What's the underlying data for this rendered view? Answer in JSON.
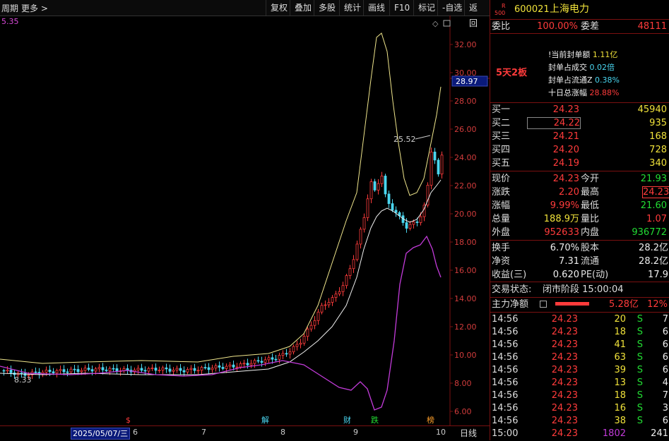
{
  "toolbar": {
    "period_label": "周期",
    "more_label": "更多 >",
    "buttons": [
      "复权",
      "叠加",
      "多股",
      "统计",
      "画线",
      "F10",
      "标记",
      "-自选",
      "返回"
    ]
  },
  "chart": {
    "ma_label": "5.35",
    "price_labels": [
      "32.00",
      "30.00",
      "28.00",
      "26.00",
      "24.00",
      "22.00",
      "20.00",
      "18.00",
      "16.00",
      "14.00",
      "12.00",
      "10.00",
      "8.00",
      "6.00"
    ],
    "current_price_tag": "28.97",
    "high_annotation": "25.52",
    "low_annotation": "8.33",
    "markers": [
      "$",
      "解",
      "财",
      "跌",
      "榜"
    ],
    "colors": {
      "up": "#ff3b3b",
      "down": "#4ad6f0",
      "band": "#f0e68c",
      "ma": "#c23bd9",
      "axis": "#7a1010"
    }
  },
  "bottom": {
    "date": "2025/05/07/三",
    "months": [
      "6",
      "7",
      "8",
      "9",
      "10"
    ],
    "period": "日线"
  },
  "panel": {
    "r_badge": "R",
    "code_badge": "500",
    "code": "600021",
    "name": "上海电力",
    "weibi_label": "委比",
    "weibi_value": "100.00%",
    "weicha_label": "委差",
    "weicha_value": "48111",
    "board_tag": "5天2板",
    "seal": [
      {
        "label": "!当前封单额",
        "value": "1.11亿"
      },
      {
        "label": "封单占成交",
        "value": "0.02倍"
      },
      {
        "label": "封单占流通Z",
        "value": "0.38%"
      },
      {
        "label": "十日总涨幅",
        "value": "28.88%"
      }
    ],
    "bids": [
      {
        "label": "买一",
        "price": "24.23",
        "volume": "45940"
      },
      {
        "label": "买二",
        "price": "24.22",
        "volume": "935"
      },
      {
        "label": "买三",
        "price": "24.21",
        "volume": "168"
      },
      {
        "label": "买四",
        "price": "24.20",
        "volume": "728"
      },
      {
        "label": "买五",
        "price": "24.19",
        "volume": "340"
      }
    ],
    "quote": [
      {
        "l1": "现价",
        "v1": "24.23",
        "l2": "今开",
        "v2": "21.93"
      },
      {
        "l1": "涨跌",
        "v1": "2.20",
        "l2": "最高",
        "v2": "24.23"
      },
      {
        "l1": "涨幅",
        "v1": "9.99%",
        "l2": "最低",
        "v2": "21.60"
      },
      {
        "l1": "总量",
        "v1": "188.9万",
        "l2": "量比",
        "v2": "1.07"
      },
      {
        "l1": "外盘",
        "v1": "952633",
        "l2": "内盘",
        "v2": "936772"
      }
    ],
    "fund": [
      {
        "l1": "换手",
        "v1": "6.70%",
        "l2": "股本",
        "v2": "28.2亿"
      },
      {
        "l1": "净资",
        "v1": "7.31",
        "l2": "流通",
        "v2": "28.2亿"
      },
      {
        "l1": "收益(三)",
        "v1": "0.620",
        "l2": "PE(动)",
        "v2": "17.9"
      }
    ],
    "status_label": "交易状态:",
    "status_value": "闭市阶段 15:00:04",
    "main_label": "主力净额",
    "main_value": "5.28亿",
    "main_pct": "12%",
    "ticks": [
      {
        "time": "14:56",
        "price": "24.23",
        "vol": "20",
        "side": "S",
        "num": "7"
      },
      {
        "time": "14:56",
        "price": "24.23",
        "vol": "18",
        "side": "S",
        "num": "6"
      },
      {
        "time": "14:56",
        "price": "24.23",
        "vol": "41",
        "side": "S",
        "num": "6"
      },
      {
        "time": "14:56",
        "price": "24.23",
        "vol": "63",
        "side": "S",
        "num": "6"
      },
      {
        "time": "14:56",
        "price": "24.23",
        "vol": "39",
        "side": "S",
        "num": "6"
      },
      {
        "time": "14:56",
        "price": "24.23",
        "vol": "13",
        "side": "S",
        "num": "4"
      },
      {
        "time": "14:56",
        "price": "24.23",
        "vol": "18",
        "side": "S",
        "num": "7"
      },
      {
        "time": "14:56",
        "price": "24.23",
        "vol": "16",
        "side": "S",
        "num": "3"
      },
      {
        "time": "14:56",
        "price": "24.23",
        "vol": "38",
        "side": "S",
        "num": "6"
      },
      {
        "time": "15:00",
        "price": "24.23",
        "vol": "1802",
        "side": "",
        "num": "241"
      }
    ]
  }
}
